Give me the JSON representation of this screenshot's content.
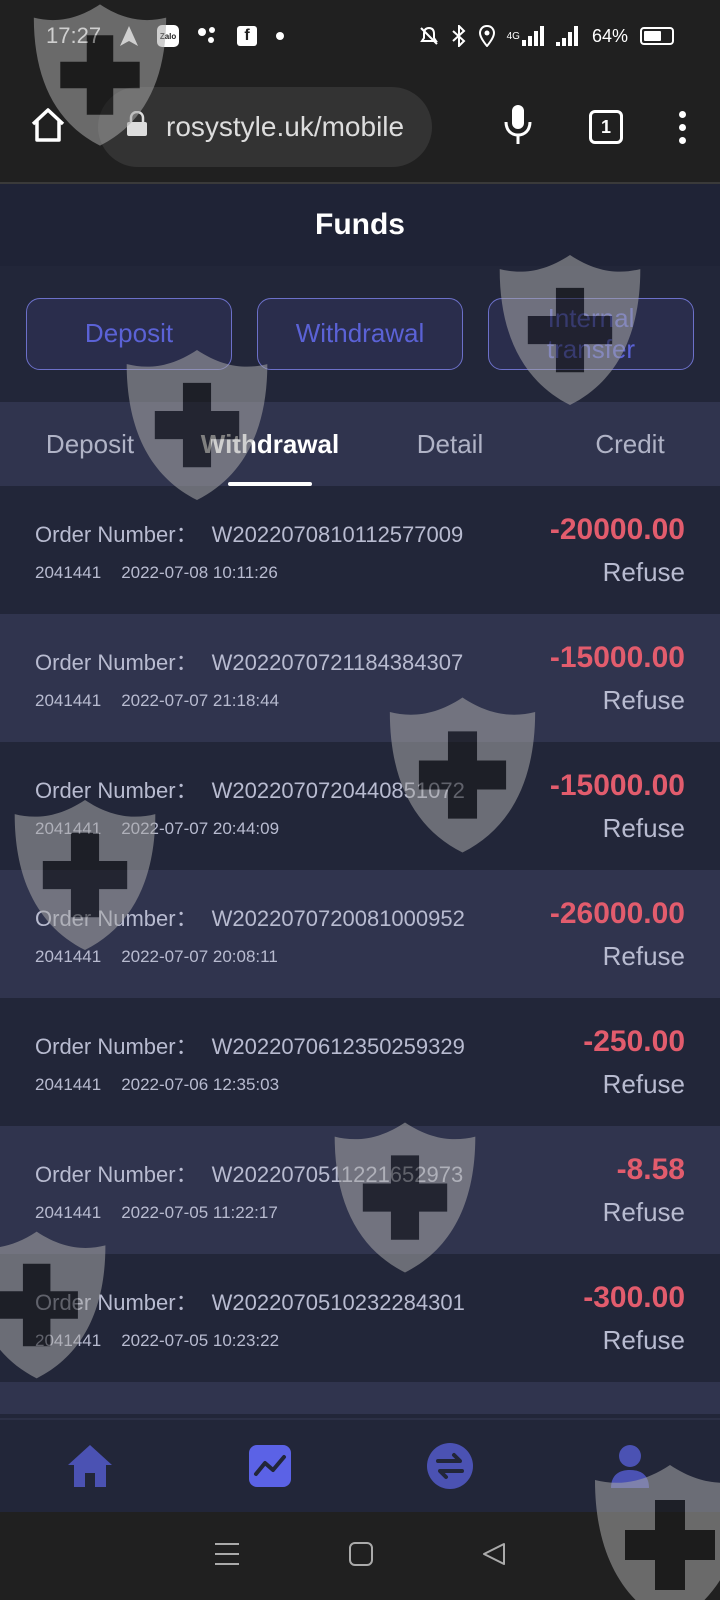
{
  "status_bar": {
    "time": "17:27",
    "zalo_label": "Zalo",
    "fb_label": "f",
    "battery": "64%",
    "battery_level": 0.64,
    "signal_label": "4G"
  },
  "browser": {
    "url": "rosystyle.uk/mobile",
    "tab_count": "1"
  },
  "page": {
    "title": "Funds"
  },
  "actions": [
    {
      "label": "Deposit"
    },
    {
      "label": "Withdrawal"
    },
    {
      "label": "Internal transfer"
    }
  ],
  "tabs": [
    {
      "label": "Deposit",
      "active": false
    },
    {
      "label": "Withdrawal",
      "active": true
    },
    {
      "label": "Detail",
      "active": false
    },
    {
      "label": "Credit",
      "active": false
    }
  ],
  "records": [
    {
      "order_label": "Order Number：",
      "order_no": "W2022070810112577009",
      "uid": "2041441",
      "datetime": "2022-07-08 10:11:26",
      "amount": "-20000.00",
      "status": "Refuse"
    },
    {
      "order_label": "Order Number：",
      "order_no": "W2022070721184384307",
      "uid": "2041441",
      "datetime": "2022-07-07 21:18:44",
      "amount": "-15000.00",
      "status": "Refuse"
    },
    {
      "order_label": "Order Number：",
      "order_no": "W2022070720440851072",
      "uid": "2041441",
      "datetime": "2022-07-07 20:44:09",
      "amount": "-15000.00",
      "status": "Refuse"
    },
    {
      "order_label": "Order Number：",
      "order_no": "W2022070720081000952",
      "uid": "2041441",
      "datetime": "2022-07-07 20:08:11",
      "amount": "-26000.00",
      "status": "Refuse"
    },
    {
      "order_label": "Order Number：",
      "order_no": "W2022070612350259329",
      "uid": "2041441",
      "datetime": "2022-07-06 12:35:03",
      "amount": "-250.00",
      "status": "Refuse"
    },
    {
      "order_label": "Order Number：",
      "order_no": "W2022070511221652973",
      "uid": "2041441",
      "datetime": "2022-07-05 11:22:17",
      "amount": "-8.58",
      "status": "Refuse"
    },
    {
      "order_label": "Order Number：",
      "order_no": "W2022070510232284301",
      "uid": "2041441",
      "datetime": "2022-07-05 10:23:22",
      "amount": "-300.00",
      "status": "Refuse"
    }
  ],
  "bottom_nav": [
    {
      "icon": "home-icon",
      "active": false
    },
    {
      "icon": "chart-icon",
      "active": true
    },
    {
      "icon": "exchange-icon",
      "active": false
    },
    {
      "icon": "user-icon",
      "active": false
    }
  ],
  "colors": {
    "accent": "#5b62d6",
    "negative": "#e25c6d",
    "background": "#222639",
    "row_alt": "#30344e"
  }
}
